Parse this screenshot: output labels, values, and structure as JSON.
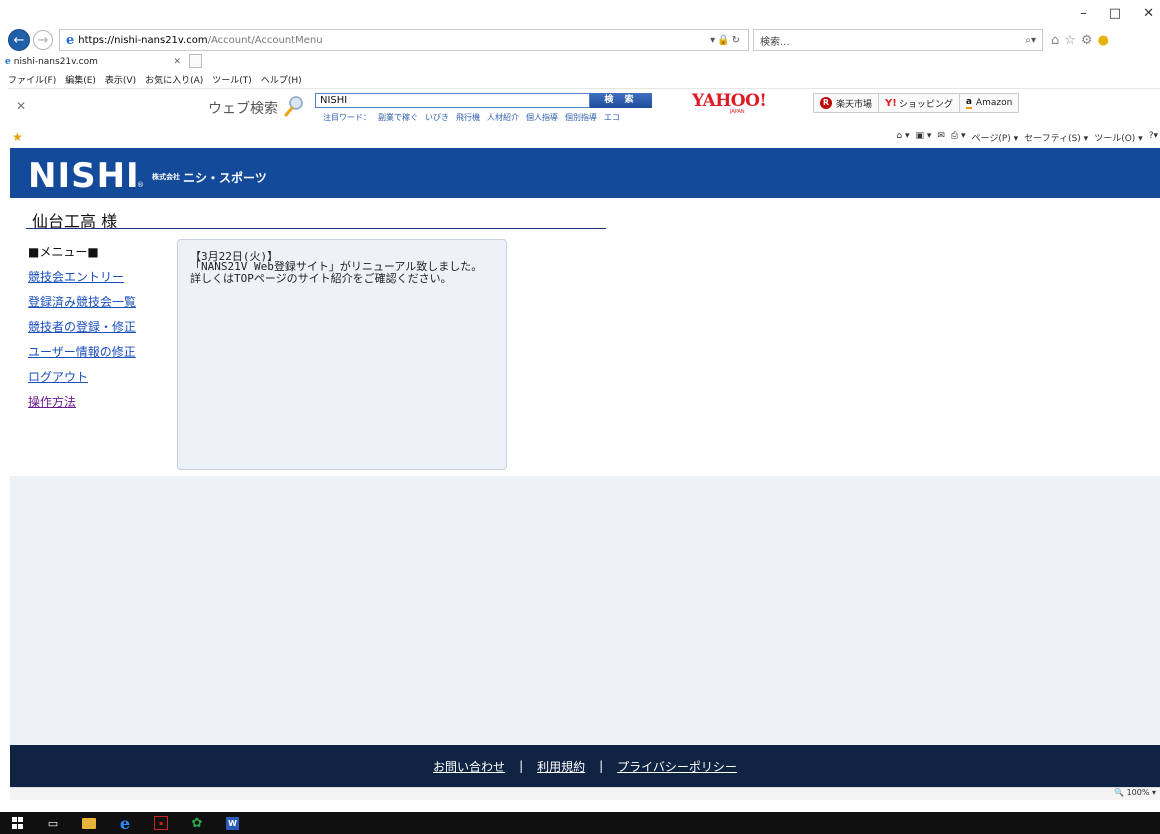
{
  "browser": {
    "url_host": "https://nishi-nans21v.com",
    "url_path": "/Account/AccountMenu",
    "search_placeholder": "検索...",
    "tab_title": "nishi-nans21v.com",
    "menu": [
      "ファイル(F)",
      "編集(E)",
      "表示(V)",
      "お気に入り(A)",
      "ツール(T)",
      "ヘルプ(H)"
    ],
    "command_bar": [
      "ページ(P) ▾",
      "セーフティ(S) ▾",
      "ツール(O) ▾"
    ],
    "zoom": "100%"
  },
  "toolbar": {
    "web_search_label": "ウェブ検索",
    "search_value": "NISHI",
    "search_button": "検 索",
    "hot_words_label": "注目ワード：",
    "hot_words": [
      "副業で稼ぐ",
      "いびき",
      "飛行機",
      "人材紹介",
      "個人指導",
      "個別指導",
      "エコ"
    ],
    "yahoo_logo": "YAHOO!",
    "yahoo_sub": "JAPAN",
    "links": [
      {
        "icon": "rakuten-icon",
        "label": "楽天市場"
      },
      {
        "icon": "yahoo-shopping-icon",
        "label": "ショッピング"
      },
      {
        "icon": "amazon-icon",
        "label": "Amazon"
      }
    ]
  },
  "site": {
    "logo_main": "NISHI",
    "logo_reg": "®",
    "logo_kk": "株式会社",
    "logo_name": "ニシ・スポーツ",
    "account_title": "仙台工高 様",
    "menu_heading": "■メニュー■",
    "menu_items": [
      "競技会エントリー",
      "登録済み競技会一覧",
      "競技者の登録・修正",
      "ユーザー情報の修正",
      "ログアウト",
      "操作方法"
    ],
    "news_date": "【3月22日(火)】",
    "news_text": "「NANS21V Web登録サイト」がリニューアル致しました。詳しくはTOPページのサイト紹介をご確認ください。",
    "footer_links": [
      "お問い合わせ",
      "利用規約",
      "プライバシーポリシー"
    ],
    "footer_sep": "|"
  },
  "colors": {
    "header_blue": "#144a9a",
    "footer_navy": "#0f2343",
    "link_blue": "#1a4fbf",
    "page_bg": "#edf1f8"
  }
}
